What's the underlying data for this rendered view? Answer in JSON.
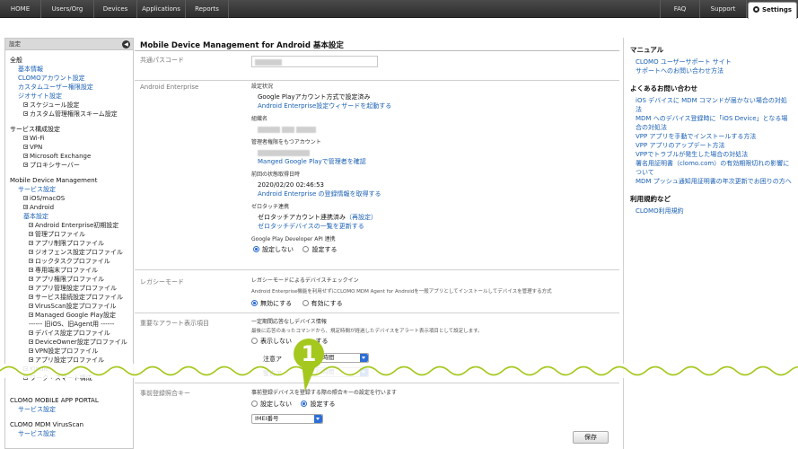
{
  "nav": {
    "tabs": [
      "HOME",
      "Users/Org",
      "Devices",
      "Applications",
      "Reports"
    ],
    "right": [
      "FAQ",
      "Support"
    ],
    "active": "Settings"
  },
  "sidebar": {
    "header": "設定",
    "sections": [
      {
        "title": "全般",
        "items": [
          {
            "label": "基本情報",
            "link": true,
            "level": 1
          },
          {
            "label": "CLOMOアカウント設定",
            "link": true,
            "level": 1
          },
          {
            "label": "カスタムユーザー権限設定",
            "link": true,
            "level": 1
          },
          {
            "label": "ジオサイト設定",
            "link": true,
            "level": 1
          },
          {
            "label": "スケジュール設定",
            "link": false,
            "level": 2,
            "box": true
          },
          {
            "label": "カスタム管理権限スキーム設定",
            "link": false,
            "level": 2,
            "box": true
          }
        ]
      },
      {
        "title": "サービス構成設定",
        "items": [
          {
            "label": "Wi-Fi",
            "link": false,
            "level": 2,
            "box": true
          },
          {
            "label": "VPN",
            "link": false,
            "level": 2,
            "box": true
          },
          {
            "label": "Microsoft Exchange",
            "link": false,
            "level": 2,
            "box": true
          },
          {
            "label": "プロキシサーバー",
            "link": false,
            "level": 2,
            "box": true
          }
        ]
      },
      {
        "title": "Mobile Device Management",
        "items": [
          {
            "label": "サービス設定",
            "link": true,
            "level": 1
          },
          {
            "label": "iOS/macOS",
            "link": false,
            "level": 2,
            "box": true
          },
          {
            "label": "Android",
            "link": false,
            "level": 2,
            "box": true
          },
          {
            "label": "基本設定",
            "link": true,
            "level": 2
          },
          {
            "label": "Android Enterprise初期設定",
            "link": false,
            "level": 3,
            "box": true
          },
          {
            "label": "管理プロファイル",
            "link": false,
            "level": 3,
            "box": true
          },
          {
            "label": "アプリ制限プロファイル",
            "link": false,
            "level": 3,
            "box": true
          },
          {
            "label": "ジオフェンス設定プロファイル",
            "link": false,
            "level": 3,
            "box": true
          },
          {
            "label": "ロックタスクプロファイル",
            "link": false,
            "level": 3,
            "box": true
          },
          {
            "label": "専用端末プロファイル",
            "link": false,
            "level": 3,
            "box": true
          },
          {
            "label": "アプリ権限プロファイル",
            "link": false,
            "level": 3,
            "box": true
          },
          {
            "label": "アプリ管理設定プロファイル",
            "link": false,
            "level": 3,
            "box": true
          },
          {
            "label": "サービス接続設定プロファイル",
            "link": false,
            "level": 3,
            "box": true
          },
          {
            "label": "VirusScan設定プロファイル",
            "link": false,
            "level": 3,
            "box": true
          },
          {
            "label": "Managed Google Play設定",
            "link": false,
            "level": 3,
            "box": true
          },
          {
            "label": "------ 旧iOS、旧Agent用 ------",
            "link": false,
            "level": 3
          },
          {
            "label": "デバイス設定プロファイル",
            "link": false,
            "level": 3,
            "box": true
          },
          {
            "label": "DeviceOwner設定プロファイル",
            "link": false,
            "level": 3,
            "box": true
          },
          {
            "label": "VPN設定プロファイル",
            "link": false,
            "level": 3,
            "box": true
          },
          {
            "label": "アプリ設定プロファイル",
            "link": false,
            "level": 3,
            "box": true
          },
          {
            "label": "Kindle",
            "link": false,
            "level": 2,
            "box": true
          },
          {
            "label": "ワーク・スマート構成",
            "link": false,
            "level": 2,
            "box": true
          }
        ]
      },
      {
        "title": "CLOMO MOBILE APP PORTAL",
        "items": [
          {
            "label": "サービス設定",
            "link": true,
            "level": 1
          }
        ]
      },
      {
        "title": "CLOMO MDM VirusScan",
        "items": [
          {
            "label": "サービス設定",
            "link": true,
            "level": 1
          }
        ]
      }
    ]
  },
  "main": {
    "title": "Mobile Device Management for Android 基本設定",
    "passcode_label": "共通パスコード",
    "ae": {
      "label": "Android Enterprise",
      "status_heading": "設定状況",
      "status_value": "Google Playアカウント方式で設定済み",
      "wizard_link": "Android Enterprise設定ウィザードを起動する",
      "org_heading": "組織名",
      "admin_heading": "管理者権限をもつアカウント",
      "admin_link": "Manged Google Playで管理者を確認",
      "last_heading": "前回の状態取得日時",
      "last_value": "2020/02/20 02:46:53",
      "last_link": "Android Enterprise の登録情報を取得する",
      "zt_heading": "ゼロタッチ連携",
      "zt_value": "ゼロタッチアカウント連携済み",
      "zt_reset": "（再設定）",
      "zt_link": "ゼロタッチデバイスの一覧を更新する",
      "gpapi_heading": "Google Play Developer API 連携",
      "gpapi_opt1": "設定しない",
      "gpapi_opt2": "設定する"
    },
    "legacy": {
      "label": "レガシーモード",
      "heading": "レガシーモードによるデバイスチェックイン",
      "desc": "Android Enterprise機能を利用せずにCLOMO MDM Agent for Androidを一般アプリとしてインストールしてデバイスを管理する方式",
      "opt1": "無効にする",
      "opt2": "有効にする"
    },
    "alert": {
      "label": "重要なアラート表示項目",
      "heading": "一定期間応答なしデバイス情報",
      "desc": "最後に応答のあったコマンドから、規定時間が経過したデバイスをアラート表示項目として設定します。",
      "opt1": "表示しない",
      "opt2": "する",
      "warn_label": "注意ア",
      "warn_value": "24時間",
      "danger_label": "警告ア",
      "danger_value": "72時間"
    },
    "prereg": {
      "label": "事前登録照合キー",
      "heading": "事前登録デバイスを登録する際の照合キーの設定を行います",
      "opt1": "設定しない",
      "opt2": "設定する",
      "select_value": "IMEI番号"
    },
    "save_label": "保存"
  },
  "right": {
    "sections": [
      {
        "title": "マニュアル",
        "links": [
          "CLOMO ユーザーサポート サイト",
          "サポートへのお問い合わせ方法"
        ]
      },
      {
        "title": "よくあるお問い合わせ",
        "links": [
          "iOS デバイスに MDM コマンドが届かない場合の対処法",
          "MDM へのデバイス登録時に「iOS Device」となる場合の対処法",
          "VPP アプリを手動でインストールする方法",
          "VPP アプリのアップデート方法",
          "VPPでトラブルが発生した場合の対処法",
          "署名用証明書（clomo.com）の有効期限切れの影響について",
          "MDM プッシュ通知用証明書の年次更新でお困りの方へ"
        ]
      },
      {
        "title": "利用規約など",
        "links": [
          "CLOMO利用規約"
        ]
      }
    ]
  },
  "badge": "1"
}
